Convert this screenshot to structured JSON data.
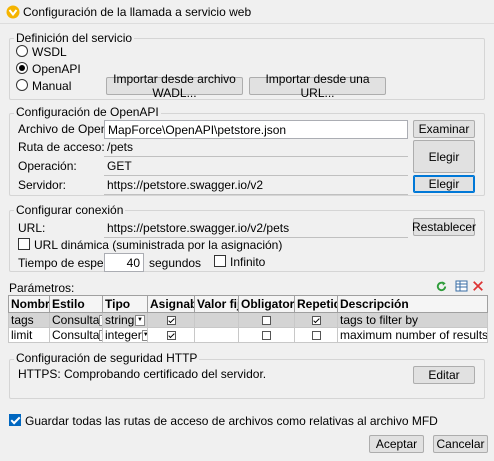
{
  "window": {
    "title": "Configuración de la llamada a servicio web"
  },
  "definition": {
    "legend": "Definición del servicio",
    "options": [
      "WSDL",
      "OpenAPI",
      "Manual"
    ],
    "selected": "OpenAPI",
    "import_file_label": "Importar desde archivo WADL...",
    "import_url_label": "Importar desde una URL..."
  },
  "openapi": {
    "legend": "Configuración de OpenAPI",
    "file_label": "Archivo de OpenAPI:",
    "file_value": "MapForce\\OpenAPI\\petstore.json",
    "browse_label": "Examinar",
    "path_label": "Ruta de acceso:",
    "path_value": "/pets",
    "operation_label": "Operación:",
    "operation_value": "GET",
    "choose_label": "Elegir",
    "server_label": "Servidor:",
    "server_value": "https://petstore.swagger.io/v2",
    "choose2_label": "Elegir"
  },
  "connection": {
    "legend": "Configurar conexión",
    "url_label": "URL:",
    "url_value": "https://petstore.swagger.io/v2/pets",
    "reset_label": "Restablecer",
    "dynamic_url_label": "URL dinámica (suministrada por la asignación)",
    "timeout_label": "Tiempo de espera:",
    "timeout_value": "40",
    "seconds_label": "segundos",
    "infinite_label": "Infinito"
  },
  "parameters": {
    "label": "Parámetros:",
    "columns": [
      "Nombre",
      "Estilo",
      "Tipo",
      "Asignable",
      "Valor fijo",
      "Obligatorio",
      "Repetido",
      "Descripción"
    ],
    "rows": [
      {
        "name": "tags",
        "style": "Consulta",
        "type": "string",
        "assignable": true,
        "fixed": "",
        "required": false,
        "repeated": true,
        "description": "tags to filter by"
      },
      {
        "name": "limit",
        "style": "Consulta",
        "type": "integer",
        "assignable": true,
        "fixed": "",
        "required": false,
        "repeated": false,
        "description": "maximum number of results to return"
      }
    ]
  },
  "security": {
    "legend": "Configuración de seguridad HTTP",
    "status": "HTTPS: Comprobando certificado del servidor.",
    "edit_label": "Editar"
  },
  "footer": {
    "relative_paths_label": "Guardar todas las rutas de acceso de archivos como relativas al archivo MFD",
    "ok_label": "Aceptar",
    "cancel_label": "Cancelar"
  },
  "colors": {
    "accent": "#0078d7",
    "check_blue": "#0067c0",
    "refresh_green": "#2e9c3a",
    "delete_red": "#d33"
  }
}
